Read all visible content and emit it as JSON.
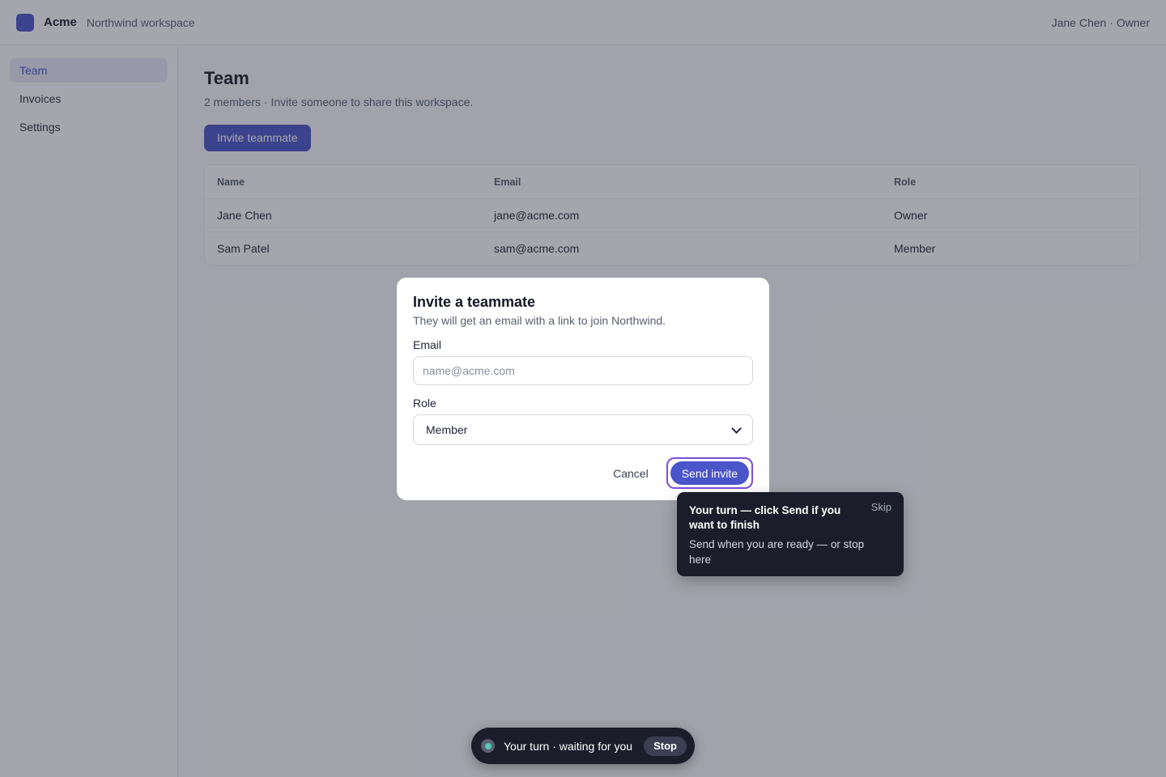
{
  "topbar": {
    "brand": "Acme",
    "workspace": "Northwind workspace",
    "user": "Jane Chen · Owner"
  },
  "sidebar": {
    "items": [
      {
        "label": "Team",
        "active": true
      },
      {
        "label": "Invoices",
        "active": false
      },
      {
        "label": "Settings",
        "active": false
      }
    ]
  },
  "main": {
    "title": "Team",
    "subtitle": "2 members · Invite someone to share this workspace.",
    "invite_button": "Invite teammate",
    "table": {
      "headers": [
        "Name",
        "Email",
        "Role"
      ],
      "rows": [
        [
          "Jane Chen",
          "jane@acme.com",
          "Owner"
        ],
        [
          "Sam Patel",
          "sam@acme.com",
          "Member"
        ]
      ]
    }
  },
  "modal": {
    "title": "Invite a teammate",
    "description": "They will get an email with a link to join Northwind.",
    "email_label": "Email",
    "email_placeholder": "name@acme.com",
    "email_value": "",
    "role_label": "Role",
    "role_value": "Member",
    "cancel_label": "Cancel",
    "send_label": "Send invite"
  },
  "tooltip": {
    "title": "Your turn — click Send if you want to finish",
    "skip": "Skip",
    "body": "Send when you are ready — or stop here"
  },
  "status": {
    "text": "Your turn · waiting for you",
    "stop_label": "Stop"
  },
  "colors": {
    "accent": "#4a55c9",
    "highlight_ring": "#7c4ddc",
    "status_dot": "#53c7b5"
  }
}
